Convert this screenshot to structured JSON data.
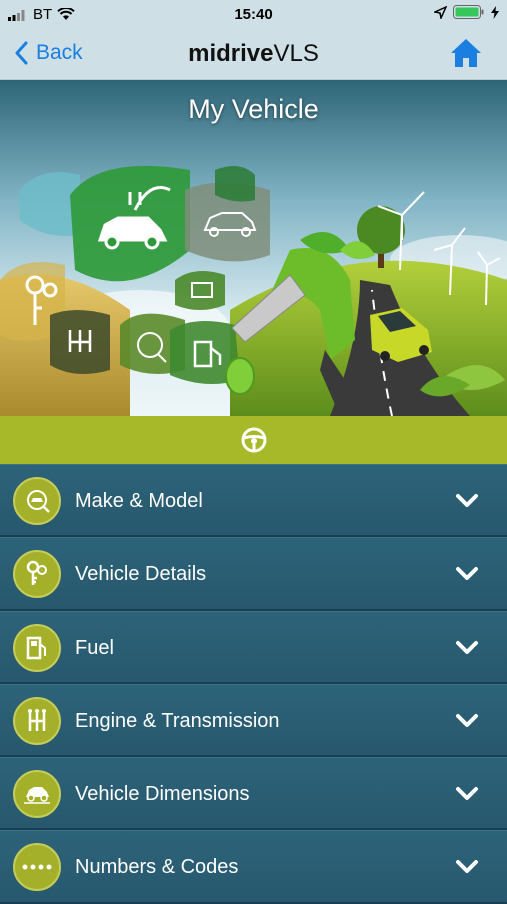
{
  "status": {
    "carrier": "BT",
    "time": "15:40"
  },
  "nav": {
    "back_label": "Back",
    "title_bold": "midrive",
    "title_light": "VLS"
  },
  "hero": {
    "title": "My Vehicle"
  },
  "menu": {
    "items": [
      {
        "label": "Make & Model",
        "icon": "magnifier-car-icon"
      },
      {
        "label": "Vehicle Details",
        "icon": "keys-icon"
      },
      {
        "label": "Fuel",
        "icon": "fuel-pump-icon"
      },
      {
        "label": "Engine & Transmission",
        "icon": "gear-stick-icon"
      },
      {
        "label": "Vehicle Dimensions",
        "icon": "car-dimensions-icon"
      },
      {
        "label": "Numbers & Codes",
        "icon": "asterisks-icon"
      }
    ]
  },
  "colors": {
    "accent": "#a7b828",
    "link": "#1a7fe0",
    "menu_bg": "#2a5d72"
  }
}
